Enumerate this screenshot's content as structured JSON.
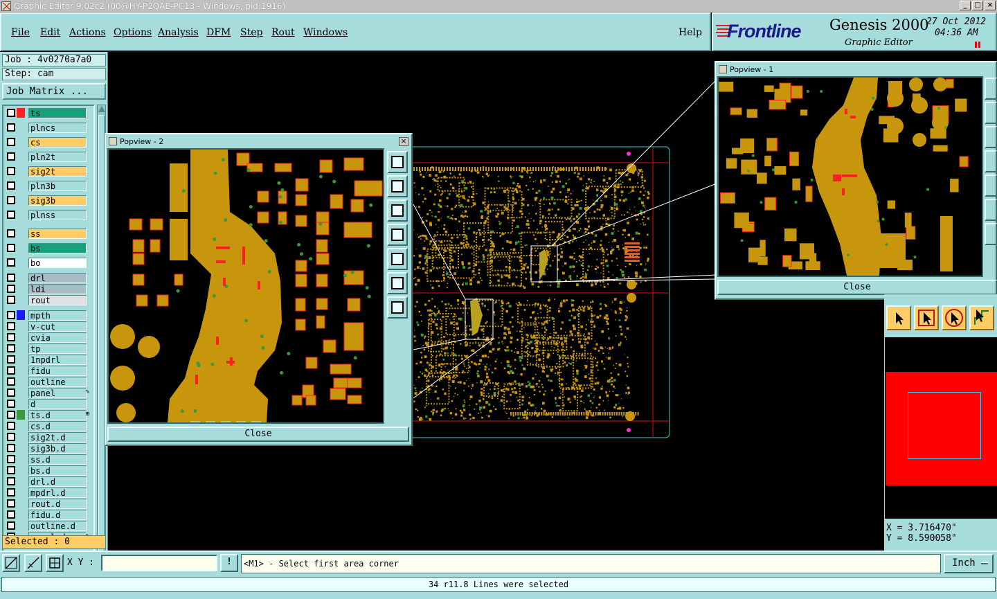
{
  "window": {
    "title": "Graphic Editor 9.02c2 (00@HY-P2QAE-PC13 - Windows, pid:1916)",
    "controls": [
      "_",
      "□",
      "×"
    ]
  },
  "menu": {
    "items": [
      "File",
      "Edit",
      "Actions",
      "Options",
      "Analysis",
      "DFM",
      "Step",
      "Rout",
      "Windows"
    ],
    "help": "Help"
  },
  "brand": {
    "logo": "Frontline",
    "product": "Genesis 2000",
    "subtitle": "Graphic Editor",
    "date": "27 Oct 2012",
    "time": "04:36 AM"
  },
  "job": {
    "job_line": "Job : 4v0270a7a0",
    "step_line": "Step: cam",
    "matrix_button": "Job Matrix ..."
  },
  "layers": [
    {
      "name": "ts",
      "color": "#17a07a",
      "swatch": "#ff2020"
    },
    {
      "name": "plncs",
      "color": "#a7dcdc",
      "swatch": ""
    },
    {
      "name": "cs",
      "color": "#ffcc66",
      "swatch": ""
    },
    {
      "name": "pln2t",
      "color": "#a7dcdc",
      "swatch": ""
    },
    {
      "name": "sig2t",
      "color": "#ffcc66",
      "swatch": ""
    },
    {
      "name": "pln3b",
      "color": "#a7dcdc",
      "swatch": ""
    },
    {
      "name": "sig3b",
      "color": "#ffcc66",
      "swatch": ""
    },
    {
      "name": "plnss",
      "color": "#a7dcdc",
      "swatch": ""
    },
    {
      "name": "ss",
      "color": "#ffcc66",
      "swatch": ""
    },
    {
      "name": "bs",
      "color": "#17a07a",
      "swatch": ""
    },
    {
      "name": "bo",
      "color": "#ffffff",
      "swatch": ""
    },
    {
      "name": "drl",
      "color": "#a8bcc8",
      "swatch": ""
    },
    {
      "name": "ldi",
      "color": "#a8bcc8",
      "swatch": ""
    },
    {
      "name": "rout",
      "color": "#e0e0e0",
      "swatch": ""
    },
    {
      "name": "mpth",
      "color": "#a7dcdc",
      "swatch": "#1a1aff"
    },
    {
      "name": "v-cut",
      "color": "#a7dcdc",
      "swatch": ""
    },
    {
      "name": "cvia",
      "color": "#a7dcdc",
      "swatch": ""
    },
    {
      "name": "tp",
      "color": "#a7dcdc",
      "swatch": ""
    },
    {
      "name": "1npdrl",
      "color": "#a7dcdc",
      "swatch": ""
    },
    {
      "name": "fidu",
      "color": "#a7dcdc",
      "swatch": ""
    },
    {
      "name": "outline",
      "color": "#a7dcdc",
      "swatch": ""
    },
    {
      "name": "panel",
      "color": "#a7dcdc",
      "swatch": "",
      "mark": "✎"
    },
    {
      "name": "d",
      "color": "#a7dcdc",
      "swatch": ""
    },
    {
      "name": "ts.d",
      "color": "#a7dcdc",
      "swatch": "#3a9a3a",
      "mark": "⊞"
    },
    {
      "name": "cs.d",
      "color": "#a7dcdc",
      "swatch": ""
    },
    {
      "name": "sig2t.d",
      "color": "#a7dcdc",
      "swatch": ""
    },
    {
      "name": "sig3b.d",
      "color": "#a7dcdc",
      "swatch": ""
    },
    {
      "name": "ss.d",
      "color": "#a7dcdc",
      "swatch": ""
    },
    {
      "name": "bs.d",
      "color": "#a7dcdc",
      "swatch": ""
    },
    {
      "name": "drl.d",
      "color": "#a7dcdc",
      "swatch": ""
    },
    {
      "name": "mpdrl.d",
      "color": "#a7dcdc",
      "swatch": ""
    },
    {
      "name": "rout.d",
      "color": "#a7dcdc",
      "swatch": ""
    },
    {
      "name": "fidu.d",
      "color": "#a7dcdc",
      "swatch": ""
    },
    {
      "name": "outline.d",
      "color": "#a7dcdc",
      "swatch": ""
    },
    {
      "name": "panel.d",
      "color": "#a7dcdc",
      "swatch": "",
      "mark": "✎"
    }
  ],
  "selected_text": "Selected : 0",
  "popview2": {
    "title": "Popview - 2",
    "close": "Close"
  },
  "popview1": {
    "title": "Popview - 1",
    "close": "Close"
  },
  "coords": {
    "x": "X = 3.716470\"",
    "y": "Y = 8.590058\""
  },
  "command": {
    "xy_label": "X Y :",
    "xy_value": "",
    "prompt": "<M1> - Select first area corner",
    "unit": "Inch"
  },
  "status": "34 r11.8 Lines were selected",
  "colors": {
    "panel": "#a7dcdc",
    "copper": "#c8960c",
    "pad_outline": "#ff2020",
    "via": "#3a9a3a",
    "highlight": "#ffcc66"
  }
}
